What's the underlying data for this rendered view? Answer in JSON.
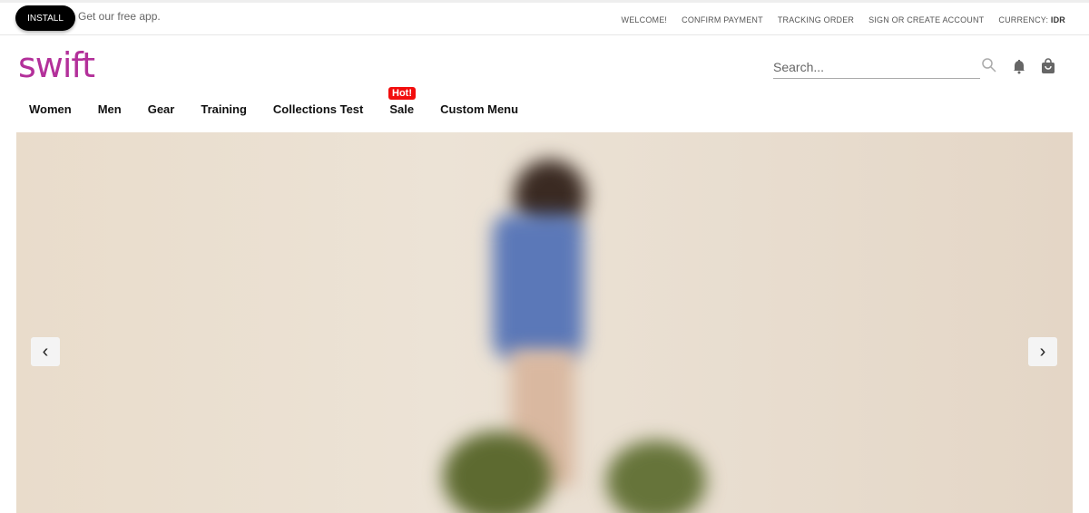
{
  "topbar": {
    "install_label": "INSTALL",
    "promo": "Get our free app.",
    "links": [
      "WELCOME!",
      "CONFIRM PAYMENT",
      "TRACKING ORDER",
      "SIGN OR CREATE ACCOUNT"
    ],
    "currency_label": "CURRENCY:",
    "currency_value": "IDR"
  },
  "header": {
    "logo": "swift",
    "search_placeholder": "Search..."
  },
  "nav": {
    "items": [
      "Women",
      "Men",
      "Gear",
      "Training",
      "Collections Test",
      "Sale",
      "Custom Menu"
    ],
    "badge": "Hot!"
  },
  "carousel": {
    "prev": "‹",
    "next": "›"
  },
  "colors": {
    "brand": "#b3309a",
    "badge": "#f20d0d"
  }
}
